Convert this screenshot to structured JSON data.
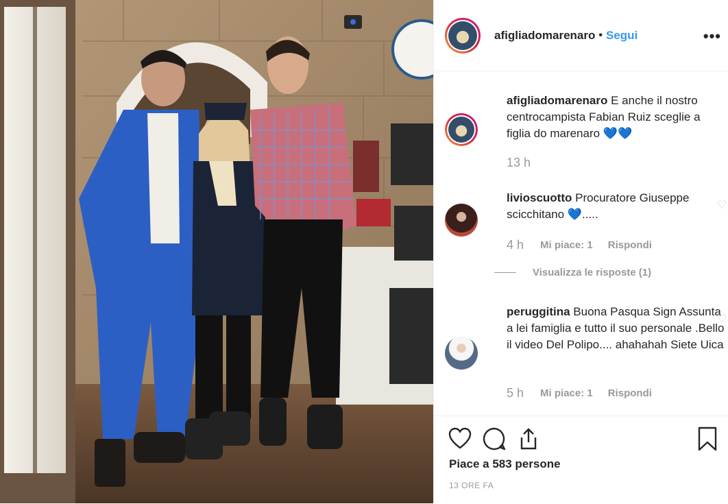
{
  "post": {
    "username": "afigliadomarenaro",
    "separator": "•",
    "follow_label": "Segui",
    "more_label": "•••"
  },
  "caption": {
    "username": "afigliadomarenaro",
    "text": "E anche il nostro centrocampista Fabian Ruiz sceglie a figlia do marenaro 💙💙",
    "time": "13 h"
  },
  "comments": [
    {
      "username": "livioscuotto",
      "text": "Procuratore Giuseppe scicchitano 💙.....",
      "time": "4 h",
      "likes": "Mi piace: 1",
      "reply": "Rispondi"
    },
    {
      "username": "peruggitina",
      "text": "Buona Pasqua Sign Assunta a lei famiglia e tutto il suo personale .Bello il video Del Polipo.... ahahahah Siete Uica",
      "time": "5 h",
      "likes": "Mi piace: 1",
      "reply": "Rispondi"
    }
  ],
  "view_replies": "Visualizza le risposte (1)",
  "footer": {
    "likes": "Piace a 583 persone",
    "posted": "13 ORE FA"
  },
  "icons": [
    "heart-icon",
    "comment-icon",
    "share-icon",
    "bookmark-icon",
    "more-icon"
  ]
}
